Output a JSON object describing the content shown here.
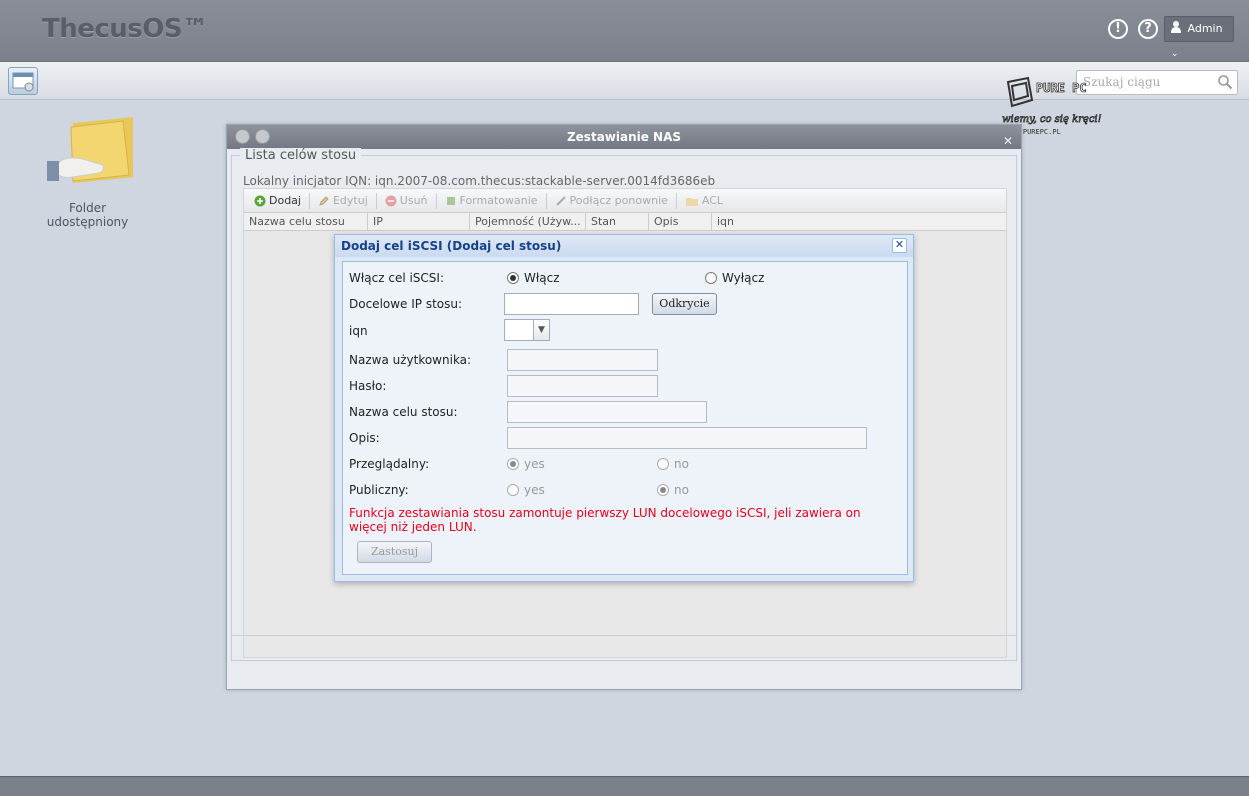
{
  "app": {
    "title": "ThecusOS™",
    "admin_label": "Admin"
  },
  "search": {
    "placeholder": "Szukaj ciągu"
  },
  "watermark": {
    "brand": "PURE PC",
    "tagline": "wiemy, co się kręci!",
    "url": "WWW.PUREPC.PL"
  },
  "desktop": {
    "folder_label": "Folder udostępniony"
  },
  "window": {
    "title": "Zestawianie NAS",
    "legend": "Lista celów stosu",
    "iqn": "Lokalny inicjator IQN: iqn.2007-08.com.thecus:stackable-server.0014fd3686eb",
    "toolbar": {
      "add": "Dodaj",
      "edit": "Edytuj",
      "delete": "Usuń",
      "format": "Formatowanie",
      "reconnect": "Podłącz ponownie",
      "acl": "ACL"
    },
    "columns": [
      "Nazwa celu stosu",
      "IP",
      "Pojemność (Używ...",
      "Stan",
      "Opis",
      "iqn"
    ]
  },
  "dialog": {
    "title": "Dodaj cel iSCSI (Dodaj cel stosu)",
    "enable_label": "Włącz cel iSCSI:",
    "enable_on": "Włącz",
    "enable_off": "Wyłącz",
    "target_ip_label": "Docelowe IP stosu:",
    "target_ip_value": "",
    "discover_button": "Odkrycie",
    "iqn_label": "iqn",
    "iqn_value": "",
    "username_label": "Nazwa użytkownika:",
    "username_value": "",
    "password_label": "Hasło:",
    "password_value": "",
    "target_name_label": "Nazwa celu stosu:",
    "target_name_value": "",
    "description_label": "Opis:",
    "description_value": "",
    "browsable_label": "Przeglądalny:",
    "browsable_yes": "yes",
    "browsable_no": "no",
    "public_label": "Publiczny:",
    "public_yes": "yes",
    "public_no": "no",
    "warning": "Funkcja zestawiania stosu zamontuje pierwszy LUN docelowego iSCSI, jeli zawiera on więcej niż jeden LUN.",
    "apply_button": "Zastosuj"
  },
  "colors": {
    "warning": "#e8001c",
    "dialog_title": "#15428b"
  }
}
